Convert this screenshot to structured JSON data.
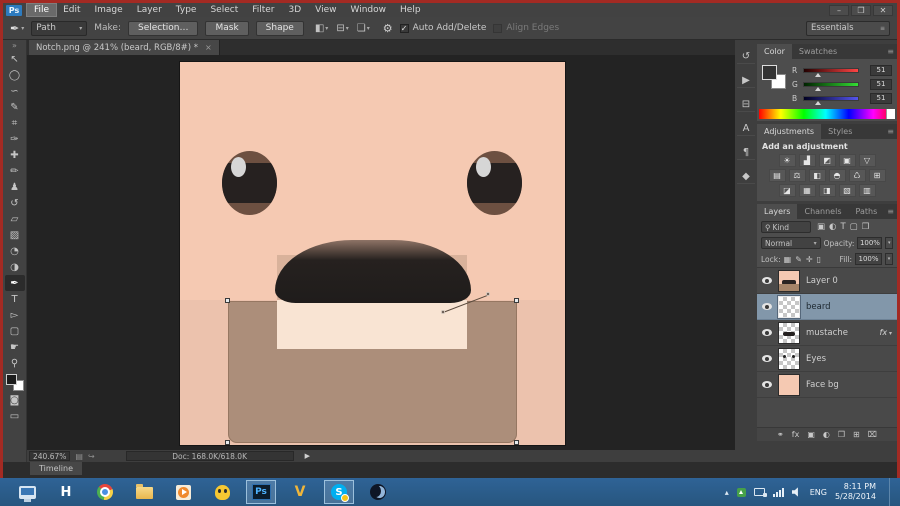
{
  "window": {
    "logo": "Ps",
    "minimize": "–",
    "restore": "❐",
    "close": "✕"
  },
  "ui": {
    "arrow": "▾",
    "collapse": "»",
    "panel_menu": "≡",
    "check": "✓"
  },
  "menubar": {
    "items": [
      {
        "name": "file",
        "label": "File",
        "active": true
      },
      {
        "name": "edit",
        "label": "Edit"
      },
      {
        "name": "image",
        "label": "Image"
      },
      {
        "name": "layer",
        "label": "Layer"
      },
      {
        "name": "type",
        "label": "Type"
      },
      {
        "name": "select",
        "label": "Select"
      },
      {
        "name": "filter",
        "label": "Filter"
      },
      {
        "name": "3d",
        "label": "3D"
      },
      {
        "name": "view",
        "label": "View"
      },
      {
        "name": "window",
        "label": "Window"
      },
      {
        "name": "help",
        "label": "Help"
      }
    ]
  },
  "options_bar": {
    "tool_glyph": "✒",
    "preset": "Path",
    "make_label": "Make:",
    "selection_button": "Selection…",
    "mask_button": "Mask",
    "shape_button": "Shape",
    "path_ops": [
      {
        "name": "path-operations",
        "glyph": "◧"
      },
      {
        "name": "path-alignment",
        "glyph": "⊟"
      },
      {
        "name": "path-arrangement",
        "glyph": "❏"
      }
    ],
    "gear_glyph": "⚙",
    "auto_add_delete": "Auto Add/Delete",
    "align_edges": "Align Edges",
    "workspace": "Essentials"
  },
  "document_tab": {
    "title": "Notch.png @ 241% (beard, RGB/8#) *",
    "close": "×"
  },
  "toolbar": {
    "tools": [
      {
        "name": "move",
        "glyph": "↖"
      },
      {
        "name": "marquee",
        "glyph": "◯"
      },
      {
        "name": "lasso",
        "glyph": "∽"
      },
      {
        "name": "quick-selection",
        "glyph": "✎"
      },
      {
        "name": "crop",
        "glyph": "⌗"
      },
      {
        "name": "eyedropper",
        "glyph": "✑"
      },
      {
        "name": "spot-healing",
        "glyph": "✚"
      },
      {
        "name": "brush",
        "glyph": "✏"
      },
      {
        "name": "clone-stamp",
        "glyph": "♟"
      },
      {
        "name": "history-brush",
        "glyph": "↺"
      },
      {
        "name": "eraser",
        "glyph": "▱"
      },
      {
        "name": "gradient",
        "glyph": "▨"
      },
      {
        "name": "blur",
        "glyph": "◔"
      },
      {
        "name": "dodge",
        "glyph": "◑"
      },
      {
        "name": "pen",
        "glyph": "✒",
        "selected": true
      },
      {
        "name": "type",
        "glyph": "T"
      },
      {
        "name": "path-selection",
        "glyph": "▻"
      },
      {
        "name": "shape",
        "glyph": "▢"
      },
      {
        "name": "hand",
        "glyph": "☛"
      },
      {
        "name": "zoom",
        "glyph": "⚲"
      }
    ],
    "extras": [
      {
        "name": "quick-mask",
        "glyph": "◙"
      },
      {
        "name": "screen-mode",
        "glyph": "▭"
      }
    ]
  },
  "dock": {
    "icons": [
      {
        "name": "history",
        "glyph": "↺"
      },
      {
        "name": "actions",
        "glyph": "▶"
      },
      {
        "name": "libraries",
        "glyph": "⊟"
      },
      {
        "name": "character",
        "glyph": "A"
      },
      {
        "name": "paragraph",
        "glyph": "¶"
      },
      {
        "name": "3d",
        "glyph": "◆"
      }
    ]
  },
  "color_panel": {
    "tabs": [
      {
        "name": "color",
        "label": "Color",
        "active": true
      },
      {
        "name": "swatches",
        "label": "Swatches"
      }
    ],
    "channels": [
      {
        "name": "red",
        "label": "R",
        "value": "51",
        "cls": "ch-r"
      },
      {
        "name": "green",
        "label": "G",
        "value": "51",
        "cls": "ch-g"
      },
      {
        "name": "blue",
        "label": "B",
        "value": "51",
        "cls": "ch-b"
      }
    ]
  },
  "adjustments_panel": {
    "tabs": [
      {
        "name": "adjustments",
        "label": "Adjustments",
        "active": true
      },
      {
        "name": "styles",
        "label": "Styles"
      }
    ],
    "heading": "Add an adjustment",
    "rows": [
      [
        {
          "name": "brightness-contrast",
          "glyph": "☀"
        },
        {
          "name": "levels",
          "glyph": "▟"
        },
        {
          "name": "curves",
          "glyph": "◩"
        },
        {
          "name": "exposure",
          "glyph": "▣"
        },
        {
          "name": "vibrance",
          "glyph": "▽"
        }
      ],
      [
        {
          "name": "hue-saturation",
          "glyph": "▤"
        },
        {
          "name": "color-balance",
          "glyph": "⚖"
        },
        {
          "name": "black-white",
          "glyph": "◧"
        },
        {
          "name": "photo-filter",
          "glyph": "◓"
        },
        {
          "name": "channel-mixer",
          "glyph": "♺"
        },
        {
          "name": "color-lookup",
          "glyph": "⊞"
        }
      ],
      [
        {
          "name": "invert",
          "glyph": "◪"
        },
        {
          "name": "posterize",
          "glyph": "▦"
        },
        {
          "name": "threshold",
          "glyph": "◨"
        },
        {
          "name": "selective-color",
          "glyph": "▧"
        },
        {
          "name": "gradient-map",
          "glyph": "▥"
        }
      ]
    ]
  },
  "layers_panel": {
    "tabs": [
      {
        "name": "layers",
        "label": "Layers",
        "active": true
      },
      {
        "name": "channels",
        "label": "Channels"
      },
      {
        "name": "paths",
        "label": "Paths"
      }
    ],
    "kind_icon": "⚲",
    "kind_label": "Kind",
    "filter_icons": [
      {
        "name": "filter-pixel-layers",
        "glyph": "▣"
      },
      {
        "name": "filter-adjustment-layers",
        "glyph": "◐"
      },
      {
        "name": "filter-type-layers",
        "glyph": "T"
      },
      {
        "name": "filter-shape-layers",
        "glyph": "▢"
      },
      {
        "name": "filter-smart-objects",
        "glyph": "❒"
      }
    ],
    "blend_mode": "Normal",
    "opacity_label": "Opacity:",
    "opacity_value": "100%",
    "lock_label": "Lock:",
    "lock_icons": [
      {
        "name": "lock-transparency",
        "glyph": "▦"
      },
      {
        "name": "lock-pixels",
        "glyph": "✎"
      },
      {
        "name": "lock-position",
        "glyph": "✛"
      },
      {
        "name": "lock-all",
        "glyph": "▯"
      }
    ],
    "fill_label": "Fill:",
    "fill_value": "100%",
    "layers": [
      {
        "name": "layer-0",
        "label": "Layer 0",
        "thumb": "face"
      },
      {
        "name": "beard",
        "label": "beard",
        "thumb": "checker",
        "selected": true
      },
      {
        "name": "mustache",
        "label": "mustache",
        "thumb": "mustache",
        "fx": "fx"
      },
      {
        "name": "eyes",
        "label": "Eyes",
        "thumb": "eyes"
      },
      {
        "name": "face-bg",
        "label": "Face bg",
        "thumb": "solid"
      }
    ],
    "footer_icons": [
      {
        "name": "link-layers",
        "glyph": "⚭"
      },
      {
        "name": "layer-style",
        "glyph": "fx"
      },
      {
        "name": "layer-mask",
        "glyph": "▣"
      },
      {
        "name": "new-adjustment-layer",
        "glyph": "◐"
      },
      {
        "name": "new-group",
        "glyph": "❒"
      },
      {
        "name": "new-layer",
        "glyph": "⊞"
      },
      {
        "name": "delete-layer",
        "glyph": "⌧"
      }
    ]
  },
  "status_bar": {
    "zoom": "240.67%",
    "icons": [
      {
        "name": "zoom-presets",
        "glyph": "▤"
      },
      {
        "name": "share",
        "glyph": "↪"
      }
    ],
    "doc_info": "Doc: 168.0K/618.0K",
    "arrow": "▶"
  },
  "timeline": {
    "label": "Timeline"
  },
  "taskbar": {
    "labels": {
      "h": "H",
      "photoshop": "Ps",
      "v": "V",
      "skype": "S"
    },
    "tray": {
      "up": "▴",
      "language": "ENG",
      "time": "8:11 PM",
      "date": "5/28/2014"
    }
  },
  "canvas": {
    "colors": {
      "skin": "#f5c9b2",
      "skin_lower": "#ecc2ad",
      "eye_ring": "#6d5041",
      "eye_dark": "#262120",
      "eye_glint": "#d6d6d6",
      "backdrop": "#d9b29b",
      "mustache": "#1f1c1b",
      "mustache_rim": "#8e7366",
      "mouth": "#f9e4d3",
      "beard": "#ac8e7a"
    }
  }
}
